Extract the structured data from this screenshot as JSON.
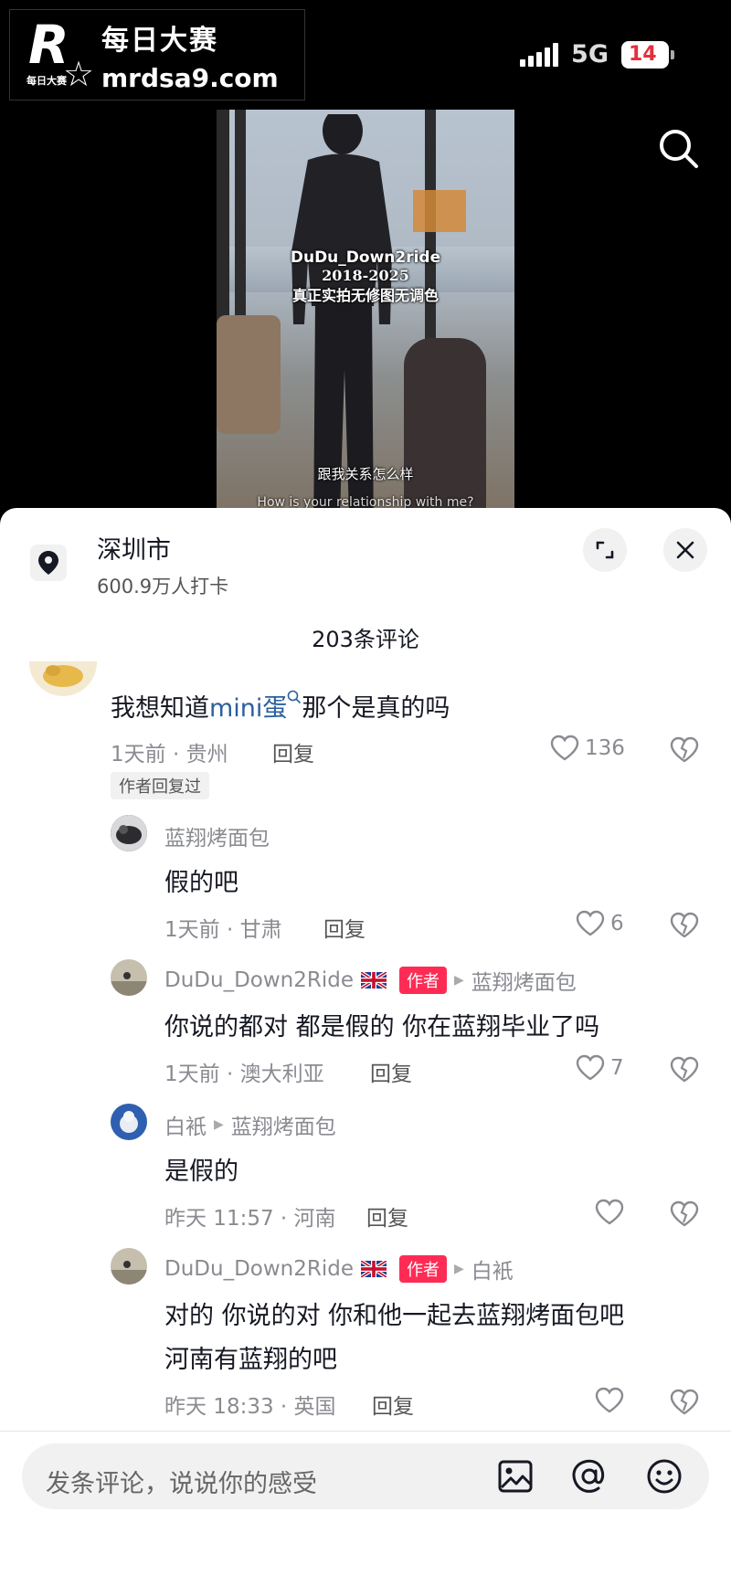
{
  "watermark": {
    "logo_letter": "R",
    "logo_small": "每日大赛",
    "title": "每日大赛",
    "url": "mrdsa9.com"
  },
  "status_bar": {
    "network": "5G",
    "battery": "14"
  },
  "video": {
    "caption_name": "DuDu_Down2ride",
    "caption_years": "2018-2025",
    "caption_note": "真正实拍无修图无调色",
    "subtitle_cn": "跟我关系怎么样",
    "subtitle_en": "How is your relationship with me?"
  },
  "location": {
    "name": "深圳市",
    "checkins": "600.9万人打卡"
  },
  "comment_count": "203条评论",
  "comments": [
    {
      "text_before": "我想知道",
      "mention": "mini蛋",
      "text_after": "那个是真的吗",
      "meta": "1天前 · 贵州",
      "reply": "回复",
      "likes": "136",
      "author_replied": "作者回复过"
    },
    {
      "user": "蓝翔烤面包",
      "text": "假的吧",
      "meta": "1天前 · 甘肃",
      "reply": "回复",
      "likes": "6"
    },
    {
      "user": "DuDu_Down2Ride",
      "tag": "作者",
      "reply_to": "蓝翔烤面包",
      "text": "你说的都对 都是假的 你在蓝翔毕业了吗",
      "meta": "1天前 · 澳大利亚",
      "reply": "回复",
      "likes": "7"
    },
    {
      "user": "白衹",
      "reply_to": "蓝翔烤面包",
      "text": "是假的",
      "meta": "昨天 11:57 · 河南",
      "reply": "回复",
      "likes": ""
    },
    {
      "user": "DuDu_Down2Ride",
      "tag": "作者",
      "reply_to": "白衹",
      "text_line1": "对的 你说的对 你和他一起去蓝翔烤面包吧",
      "text_line2": "河南有蓝翔的吧",
      "meta": "昨天 18:33 · 英国",
      "reply": "回复",
      "likes": ""
    }
  ],
  "input": {
    "placeholder": "发条评论，说说你的感受"
  },
  "colors": {
    "author_tag": "#fe2c55",
    "mention": "#2b5f9e",
    "battery_text": "#e52e3d"
  }
}
